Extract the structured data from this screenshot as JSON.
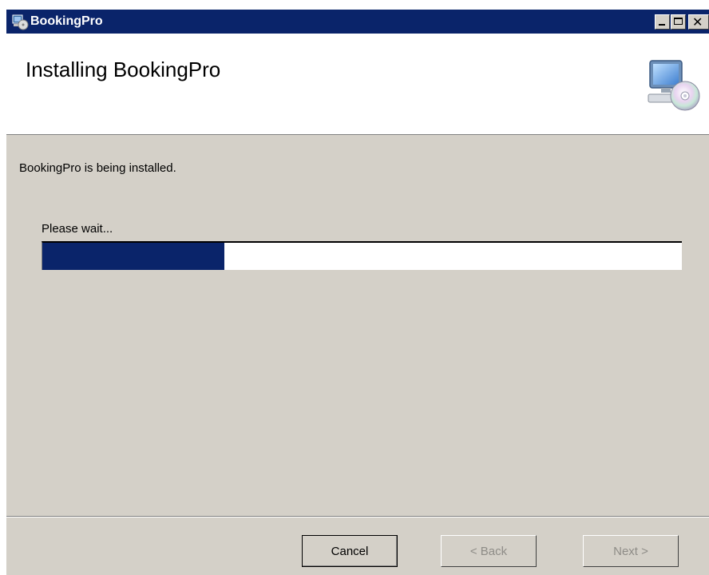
{
  "window": {
    "title": "BookingPro",
    "controls": {
      "minimize": "minimize",
      "maximize": "maximize",
      "close": "✕"
    }
  },
  "banner": {
    "title": "Installing BookingPro",
    "icon": "computer-cd-icon"
  },
  "main": {
    "status_text": "BookingPro is being installed.",
    "wait_text": "Please wait...",
    "progress_fraction": 0.285
  },
  "footer": {
    "cancel_label": "Cancel",
    "back_label": "< Back",
    "next_label": "Next >"
  },
  "colors": {
    "titlebar": "#0a246a",
    "progress_fill": "#0a246a",
    "dialog_bg": "#d4d0c8"
  }
}
